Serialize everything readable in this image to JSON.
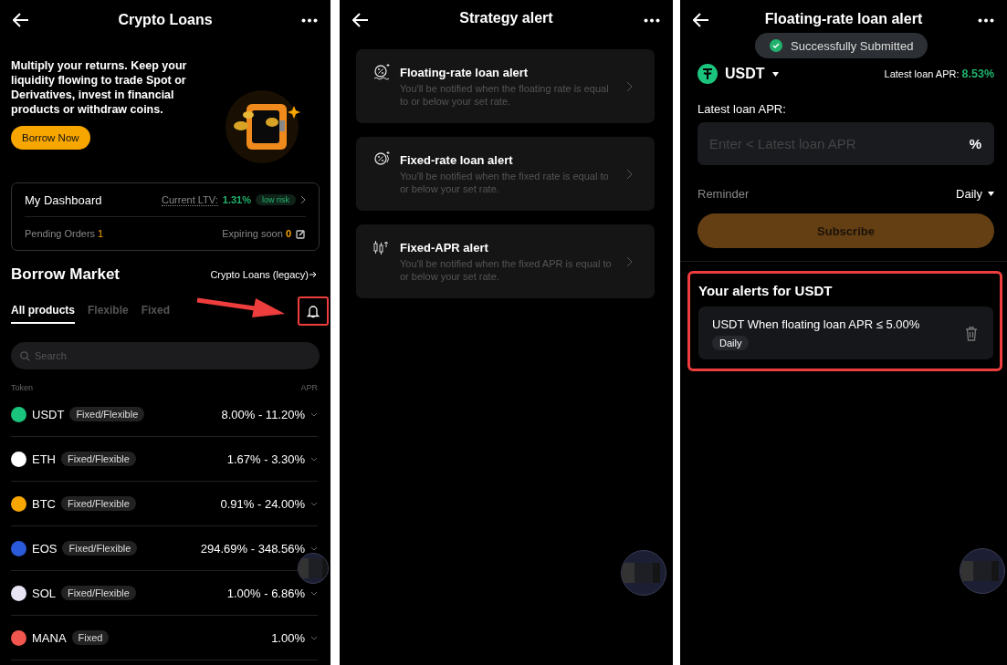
{
  "loans_screen": {
    "title": "Crypto Loans",
    "promo": {
      "text": "Multiply your returns. Keep your liquidity flowing to trade Spot or Derivatives, invest in financial products or withdraw coins.",
      "button": "Borrow Now"
    },
    "dashboard": {
      "title": "My Dashboard",
      "ltv_label": "Current LTV:",
      "ltv_value": "1.31%",
      "risk_badge": "low risk",
      "pending_label": "Pending Orders",
      "pending_value": "1",
      "expiring_label": "Expiring soon",
      "expiring_value": "0"
    },
    "market": {
      "title": "Borrow Market",
      "legacy_link": "Crypto Loans (legacy)"
    },
    "tabs": [
      {
        "label": "All products",
        "selected": true
      },
      {
        "label": "Flexible",
        "selected": false
      },
      {
        "label": "Fixed",
        "selected": false
      }
    ],
    "search": {
      "placeholder": "Search"
    },
    "table": {
      "columns": [
        "Token",
        "APR"
      ],
      "rows": [
        {
          "token": "USDT",
          "color": "#1bc47d",
          "tag": "Fixed/Flexible",
          "apr": "8.00% - 11.20%"
        },
        {
          "token": "ETH",
          "color": "#ffffff",
          "tag": "Fixed/Flexible",
          "apr": "1.67% - 3.30%"
        },
        {
          "token": "BTC",
          "color": "#f7a600",
          "tag": "Fixed/Flexible",
          "apr": "0.91% - 24.00%"
        },
        {
          "token": "EOS",
          "color": "#2a5ada",
          "tag": "Fixed/Flexible",
          "apr": "294.69% - 348.56%"
        },
        {
          "token": "SOL",
          "color": "#e8e4f4",
          "tag": "Fixed/Flexible",
          "apr": "1.00% - 6.86%"
        },
        {
          "token": "MANA",
          "color": "#f0564e",
          "tag": "Fixed",
          "apr": "1.00%"
        }
      ]
    }
  },
  "strategy_screen": {
    "title": "Strategy alert",
    "alerts": [
      {
        "kind": "floating",
        "title": "Floating-rate loan alert",
        "description": "You'll be notified when the floating rate is equal to or below your set rate."
      },
      {
        "kind": "fixed",
        "title": "Fixed-rate loan alert",
        "description": "You'll be notified when the fixed rate is equal to or below your set rate."
      },
      {
        "kind": "apr",
        "title": "Fixed-APR alert",
        "description": "You'll be notified when the fixed APR is equal to or below your set rate."
      }
    ]
  },
  "alert_screen": {
    "title": "Floating-rate loan alert",
    "toast": "Successfully Submitted",
    "token": "USDT",
    "latest_label": "Latest loan APR:",
    "latest_value": "8.53%",
    "input_label": "Latest loan APR:",
    "input_placeholder": "Enter < Latest loan APR",
    "unit": "%",
    "reminder_label": "Reminder",
    "reminder_value": "Daily",
    "subscribe": {
      "label": "Subscribe",
      "disabled": true
    },
    "alerts_title": "Your alerts for USDT",
    "alerts": [
      {
        "text": "USDT When floating loan APR ≤ 5.00%",
        "frequency": "Daily"
      }
    ]
  }
}
